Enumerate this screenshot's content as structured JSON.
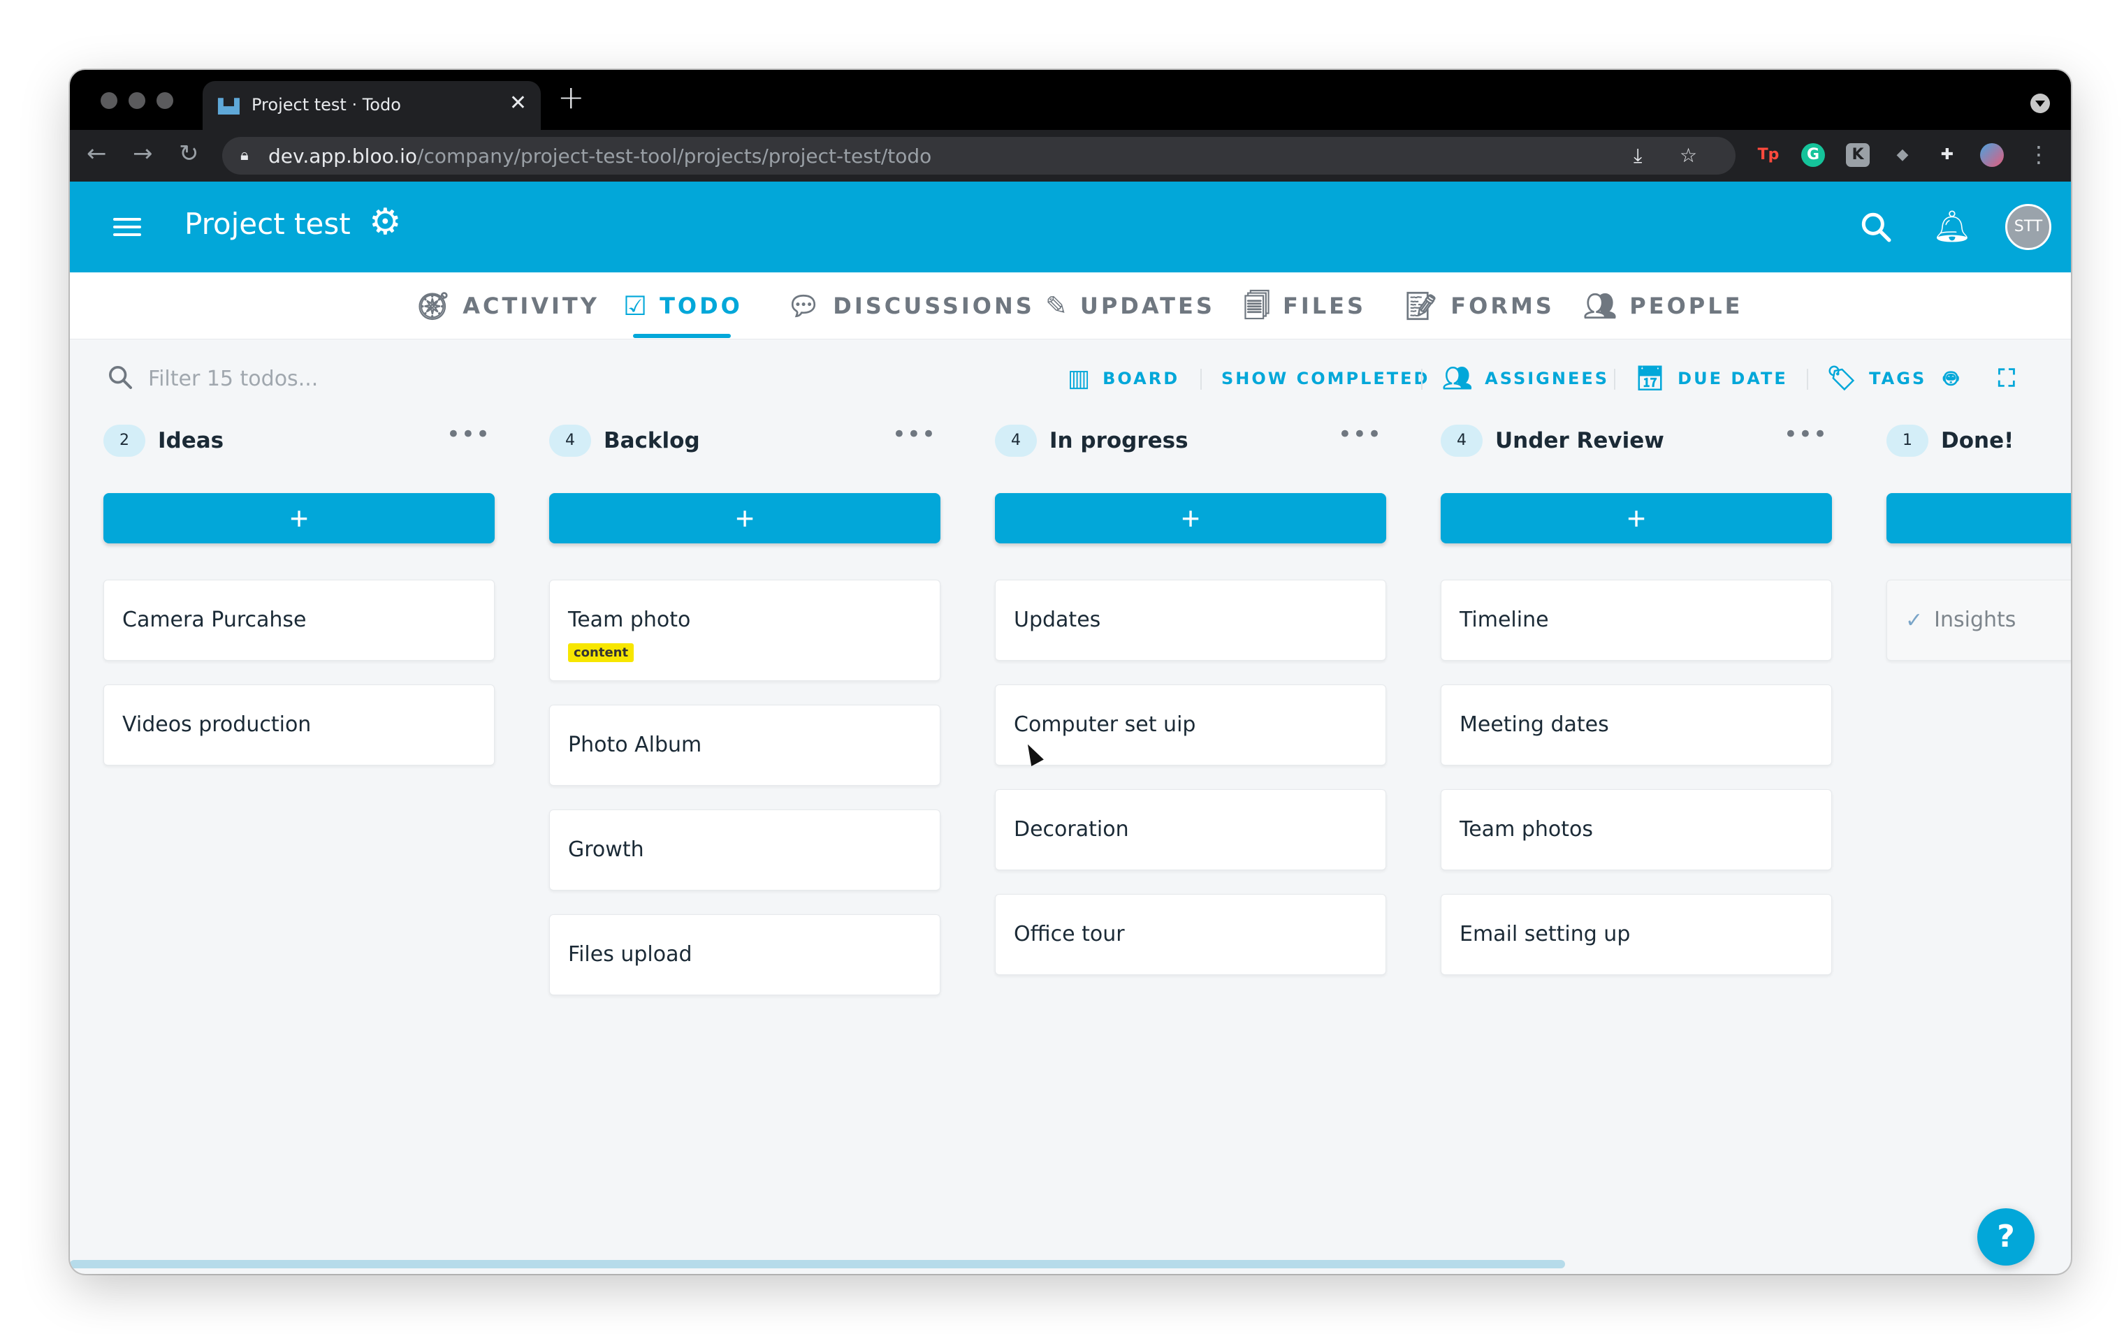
{
  "browser": {
    "tab_title": "Project test · Todo",
    "tab_close": "✕",
    "new_tab": "+",
    "url_host": "dev.app.bloo.io",
    "url_path": "/company/project-test-tool/projects/project-test/todo",
    "extensions": [
      {
        "label": "Tp",
        "color": "#ff4a3d"
      },
      {
        "label": "G",
        "color": "#15c39a"
      },
      {
        "label": "K",
        "color": "#9aa0a6"
      }
    ]
  },
  "header": {
    "project_title": "Project test",
    "avatar_initials": "STT"
  },
  "nav": {
    "tabs": [
      {
        "label": "ACTIVITY",
        "icon": "compass-icon",
        "active": false
      },
      {
        "label": "TODO",
        "icon": "checkbox-icon",
        "active": true
      },
      {
        "label": "DISCUSSIONS",
        "icon": "chat-icon",
        "active": false
      },
      {
        "label": "UPDATES",
        "icon": "edit-document-icon",
        "active": false
      },
      {
        "label": "FILES",
        "icon": "files-icon",
        "active": false
      },
      {
        "label": "FORMS",
        "icon": "form-icon",
        "active": false
      },
      {
        "label": "PEOPLE",
        "icon": "people-icon",
        "active": false
      }
    ]
  },
  "filter": {
    "placeholder": "Filter 15 todos..."
  },
  "tools": {
    "board": "BOARD",
    "show_completed": "SHOW COMPLETED",
    "assignees": "ASSIGNEES",
    "due_date": "DUE DATE",
    "tags": "TAGS"
  },
  "columns": [
    {
      "count": "2",
      "title": "Ideas",
      "more": "•••",
      "add": "+",
      "cards": [
        {
          "title": "Camera Purcahse"
        },
        {
          "title": "Videos production"
        }
      ]
    },
    {
      "count": "4",
      "title": "Backlog",
      "more": "•••",
      "add": "+",
      "cards": [
        {
          "title": "Team photo",
          "tag": "content"
        },
        {
          "title": "Photo Album"
        },
        {
          "title": "Growth"
        },
        {
          "title": "Files upload"
        }
      ]
    },
    {
      "count": "4",
      "title": "In progress",
      "more": "•••",
      "add": "+",
      "cards": [
        {
          "title": "Updates"
        },
        {
          "title": "Computer set uip"
        },
        {
          "title": "Decoration"
        },
        {
          "title": "Office tour"
        }
      ]
    },
    {
      "count": "4",
      "title": "Under Review",
      "more": "•••",
      "add": "+",
      "cards": [
        {
          "title": "Timeline"
        },
        {
          "title": "Meeting dates"
        },
        {
          "title": "Team photos"
        },
        {
          "title": "Email setting up"
        }
      ]
    },
    {
      "count": "1",
      "title": "Done!",
      "more": "",
      "add": "",
      "cards": [
        {
          "title": "Insights",
          "check": "✓"
        }
      ]
    }
  ],
  "help": {
    "label": "?"
  },
  "colors": {
    "accent": "#02a7d9",
    "badge": "#d4eef8",
    "tag": "#f7e600",
    "background": "#f4f6f8"
  }
}
